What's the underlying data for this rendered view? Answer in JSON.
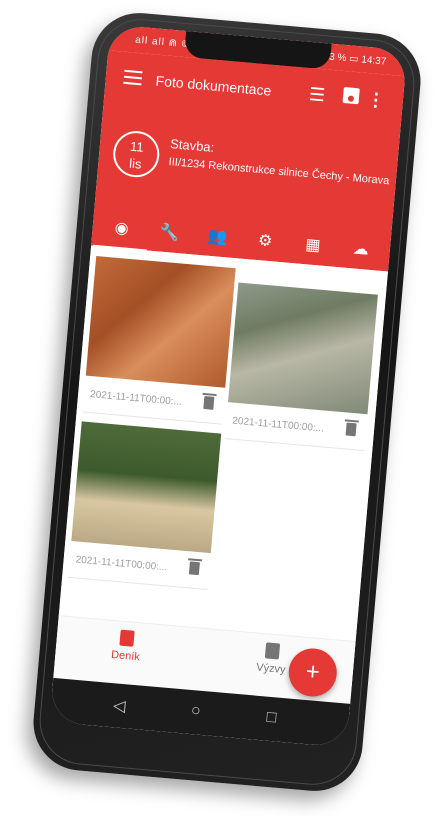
{
  "status_bar": {
    "left": "all all ⋒ ©",
    "right": "3 % ▭ 14:37"
  },
  "app_bar": {
    "title": "Foto dokumentace"
  },
  "date_badge": {
    "day": "11",
    "month": "lis"
  },
  "stavba": {
    "label": "Stavba:",
    "value": "III/1234 Rekonstrukce silnice Čechy - Morava"
  },
  "tabs": [
    {
      "icon": "camera-icon",
      "active": true
    },
    {
      "icon": "wrench-icon",
      "active": false
    },
    {
      "icon": "people-icon",
      "active": false
    },
    {
      "icon": "settings-icon",
      "active": false
    },
    {
      "icon": "grid-icon",
      "active": false
    },
    {
      "icon": "cloud-icon",
      "active": false
    }
  ],
  "photos": [
    {
      "timestamp": "2021-11-11T00:00:..."
    },
    {
      "timestamp": "2021-11-11T00:00:..."
    },
    {
      "timestamp": "2021-11-11T00:00:..."
    }
  ],
  "fab": {
    "label": "+"
  },
  "bottom_nav": [
    {
      "label": "Deník",
      "active": true
    },
    {
      "label": "Výzvy",
      "active": false
    }
  ],
  "colors": {
    "primary": "#e53935"
  }
}
